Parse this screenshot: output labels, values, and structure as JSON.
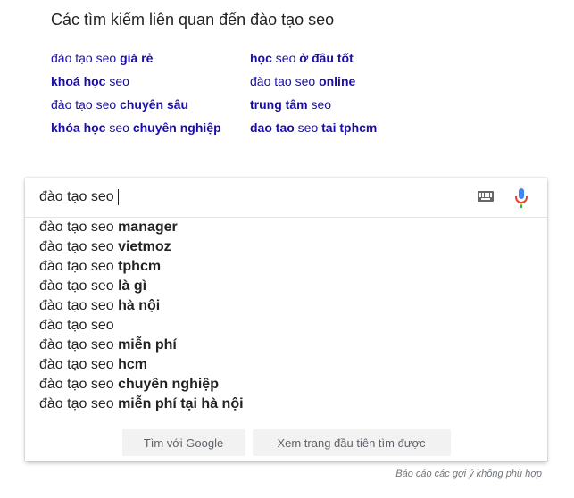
{
  "related": {
    "title": "Các tìm kiếm liên quan đến đào tạo seo",
    "links": [
      {
        "parts": [
          {
            "t": "đào tạo seo ",
            "b": false
          },
          {
            "t": "giá rẻ",
            "b": true
          }
        ]
      },
      {
        "parts": [
          {
            "t": "học",
            "b": true
          },
          {
            "t": " seo ",
            "b": false
          },
          {
            "t": "ở đâu tốt",
            "b": true
          }
        ]
      },
      {
        "parts": [
          {
            "t": "khoá học",
            "b": true
          },
          {
            "t": " seo",
            "b": false
          }
        ]
      },
      {
        "parts": [
          {
            "t": "đào tạo seo ",
            "b": false
          },
          {
            "t": "online",
            "b": true
          }
        ]
      },
      {
        "parts": [
          {
            "t": "đào tạo seo ",
            "b": false
          },
          {
            "t": "chuyên sâu",
            "b": true
          }
        ]
      },
      {
        "parts": [
          {
            "t": "trung tâm",
            "b": true
          },
          {
            "t": " seo",
            "b": false
          }
        ]
      },
      {
        "parts": [
          {
            "t": "khóa học",
            "b": true
          },
          {
            "t": " seo ",
            "b": false
          },
          {
            "t": "chuyên nghiệp",
            "b": true
          }
        ]
      },
      {
        "parts": [
          {
            "t": "dao tao",
            "b": true
          },
          {
            "t": " seo ",
            "b": false
          },
          {
            "t": "tai tphcm",
            "b": true
          }
        ]
      }
    ]
  },
  "search": {
    "query": "đào tạo seo",
    "keyboard_icon": "keyboard-icon",
    "mic_icon": "microphone-icon"
  },
  "suggestions": [
    {
      "prefix": "đào tạo seo ",
      "rest": "manager"
    },
    {
      "prefix": "đào tạo seo ",
      "rest": "vietmoz"
    },
    {
      "prefix": "đào tạo seo ",
      "rest": "tphcm"
    },
    {
      "prefix": "đào tạo seo ",
      "rest": "là gì"
    },
    {
      "prefix": "đào tạo seo ",
      "rest": "hà nội"
    },
    {
      "prefix": "đào tạo seo",
      "rest": ""
    },
    {
      "prefix": "đào tạo seo ",
      "rest": "miễn phí"
    },
    {
      "prefix": "đào tạo seo ",
      "rest": "hcm"
    },
    {
      "prefix": "đào tạo seo ",
      "rest": "chuyên nghiệp"
    },
    {
      "prefix": "đào tạo seo ",
      "rest": "miễn phí tại hà nội"
    }
  ],
  "buttons": {
    "google_search": "Tìm với Google",
    "lucky": "Xem trang đầu tiên tìm được"
  },
  "report_text": "Báo cáo các gợi ý không phù hợp",
  "colors": {
    "link": "#1a0dab",
    "mic_blue": "#4285f4",
    "mic_red": "#ea4335",
    "mic_yellow": "#fbbc05",
    "mic_green": "#34a853"
  }
}
